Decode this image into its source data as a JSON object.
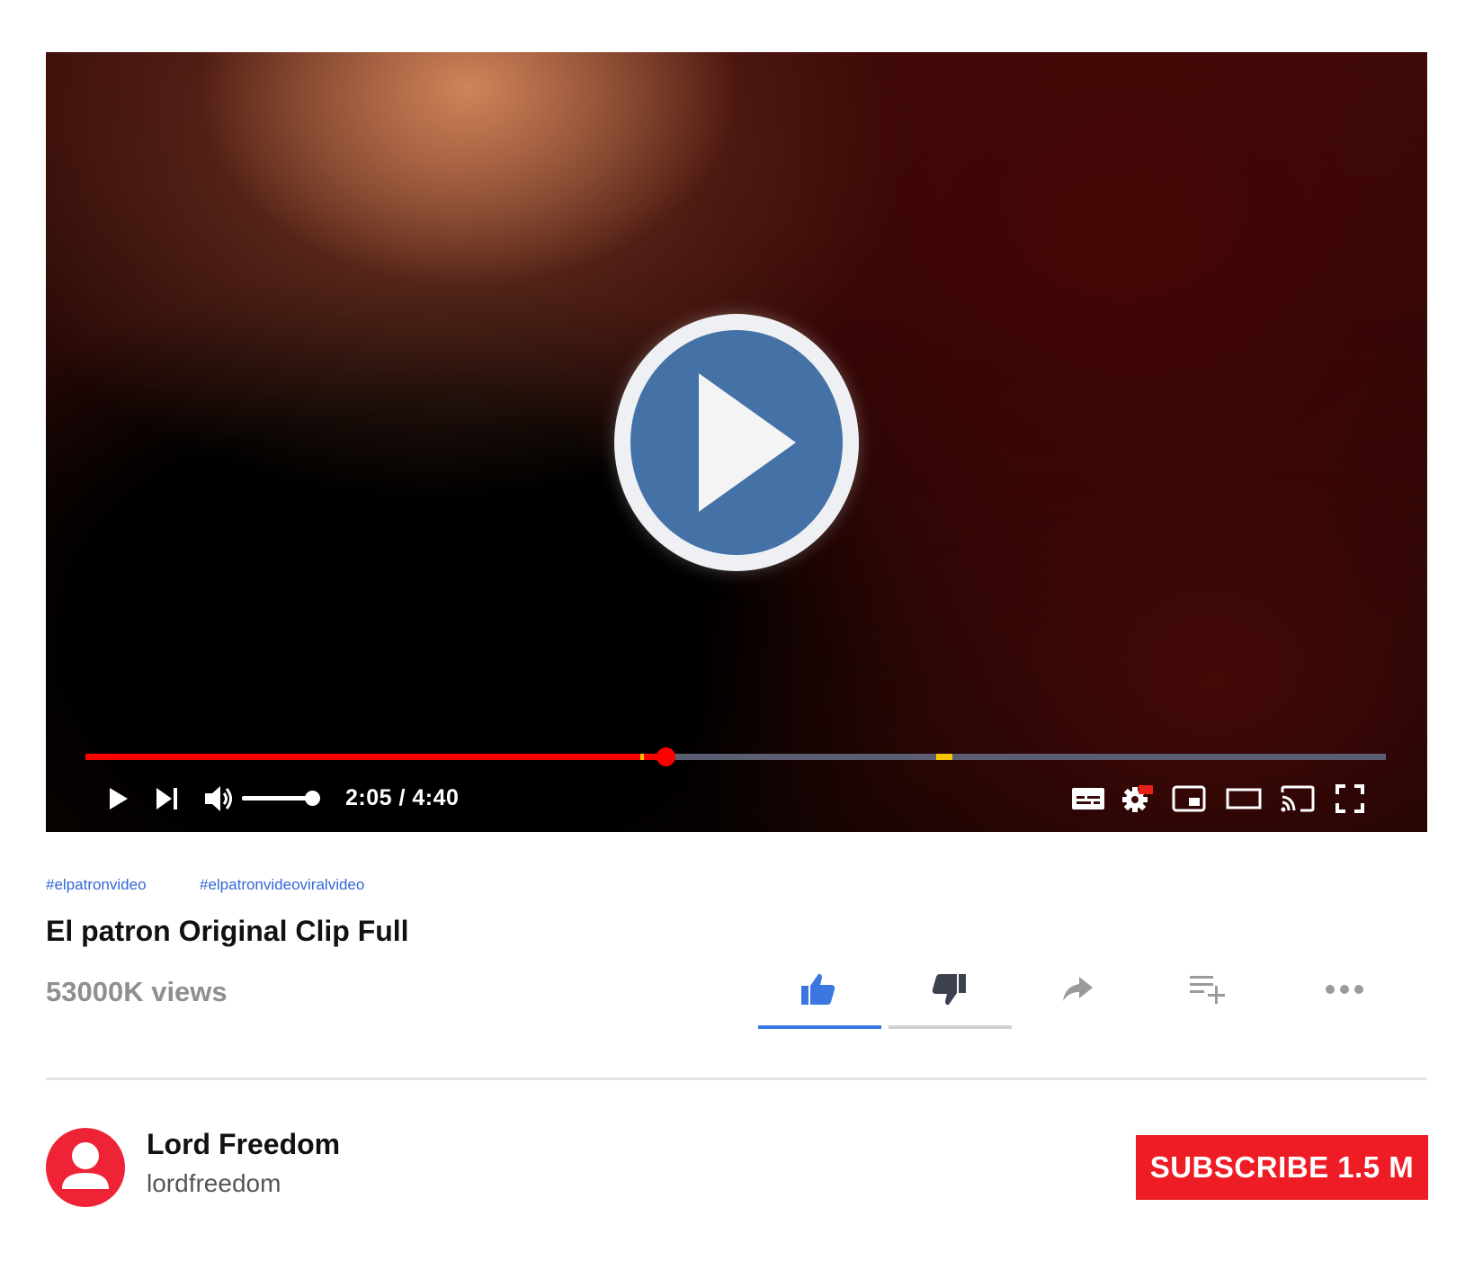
{
  "player": {
    "current_time": "2:05",
    "duration": "4:40",
    "time_display": "2:05 / 4:40",
    "progress_fraction": 0.446,
    "chapter_marker_fractions": [
      0.427,
      0.654
    ],
    "volume_fraction": 1.0,
    "colors": {
      "progress": "#ff0000",
      "marker": "#f7c400",
      "play_button": "#4471a6"
    },
    "controls": [
      "play-icon",
      "next-icon",
      "volume-icon",
      "subtitles-icon",
      "settings-hd-icon",
      "miniplayer-icon",
      "theater-mode-icon",
      "cast-icon",
      "fullscreen-icon"
    ],
    "hd_badge": "HD"
  },
  "hashtags": [
    "#elpatronvideo",
    "#elpatronvideoviralvideo"
  ],
  "video": {
    "title": "El patron Original Clip Full",
    "views": "53000K views"
  },
  "actions": [
    "like-icon",
    "dislike-icon",
    "share-icon",
    "add-to-playlist-icon",
    "more-icon"
  ],
  "channel": {
    "name": "Lord Freedom",
    "handle": "lordfreedom",
    "subscribe_label": "SUBSCRIBE 1.5 M",
    "colors": {
      "avatar": "#ee2436",
      "subscribe": "#ee1c25"
    }
  }
}
